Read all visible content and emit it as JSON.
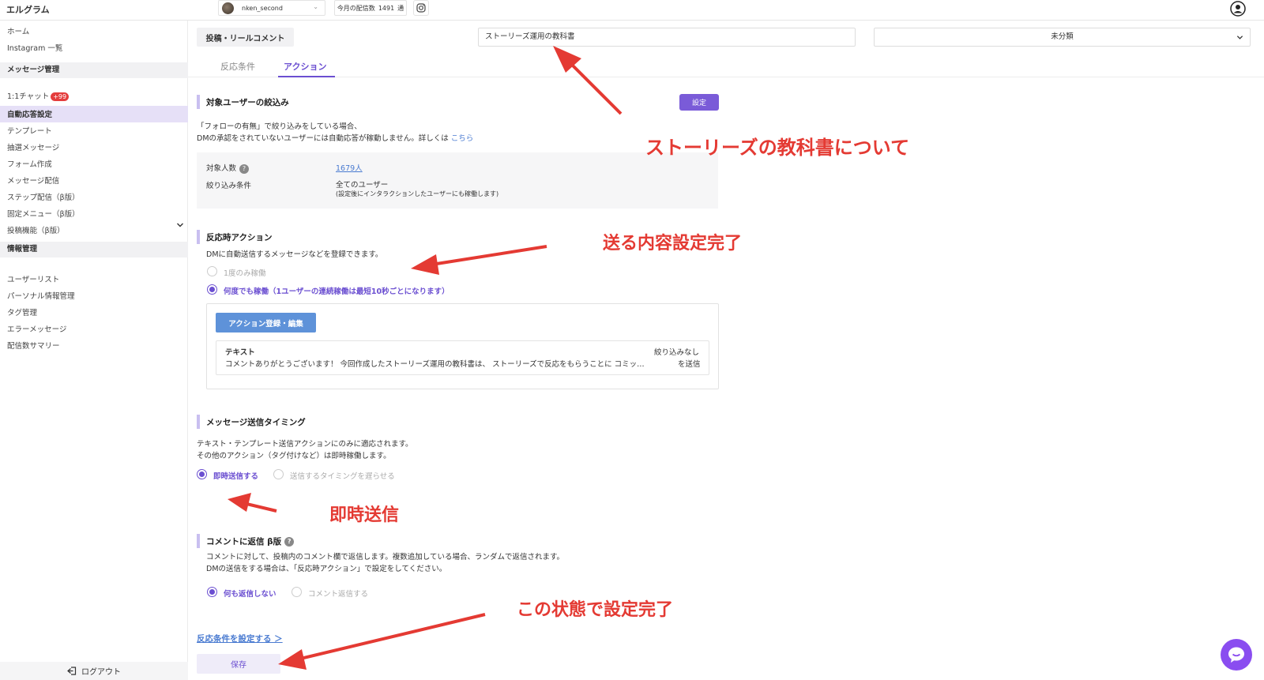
{
  "app": {
    "brand": "エルグラム"
  },
  "header": {
    "account_name": "nken_second",
    "count_label": "今月の配信数",
    "count_value": "1491",
    "count_unit": "通"
  },
  "sidebar": {
    "home": "ホーム",
    "instagram_list": "Instagram 一覧",
    "section_message": "メッセージ管理",
    "chat": "1:1チャット",
    "chat_badge": "+99",
    "auto_reply": "自動応答設定",
    "template": "テンプレート",
    "lottery": "抽選メッセージ",
    "form": "フォーム作成",
    "broadcast": "メッセージ配信",
    "step": "ステップ配信（β版）",
    "fixed_menu": "固定メニュー（β版）",
    "post_feature": "投稿機能（β版）",
    "section_info": "情報管理",
    "user_list": "ユーザーリスト",
    "personal_info": "パーソナル情報管理",
    "tag": "タグ管理",
    "error_msg": "エラーメッセージ",
    "summary": "配信数サマリー",
    "logout": "ログアウト"
  },
  "main": {
    "type_pill": "投稿・リールコメント",
    "title_value": "ストーリーズ運用の教科書",
    "category": "未分類",
    "tabs": [
      {
        "label": "反応条件"
      },
      {
        "label": "アクション"
      }
    ],
    "filter": {
      "title": "対象ユーザーの絞込み",
      "set_button": "設定",
      "note1": "「フォローの有無」で絞り込みをしている場合、",
      "note2": "DMの承認をされていないユーザーには自動応答が稼動しません。詳しくは",
      "note_link": "こちら",
      "count_label": "対象人数",
      "count_value": "1679人",
      "cond_label": "絞り込み条件",
      "cond_value": "全てのユーザー",
      "cond_note": "(設定後にインタラクションしたユーザーにも稼働します)"
    },
    "reaction": {
      "title": "反応時アクション",
      "desc": "DMに自動送信するメッセージなどを登録できます。",
      "opt_once": "1度のみ稼働",
      "opt_many": "何度でも稼働（1ユーザーの連続稼働は最短10秒ごとになります）",
      "action_button": "アクション登録・編集",
      "card_title": "テキスト",
      "card_body": "コメントありがとうございます！ 今回作成したストーリーズ運用の教科書は、 ストーリーズで反応をもらうことに コミッ…",
      "card_right1": "絞り込みなし",
      "card_right2": "を送信"
    },
    "timing": {
      "title": "メッセージ送信タイミング",
      "desc1": "テキスト・テンプレート送信アクションにのみに適応されます。",
      "desc2": "その他のアクション（タグ付けなど）は即時稼働します。",
      "opt_now": "即時送信する",
      "opt_delay": "送信するタイミングを遅らせる"
    },
    "comment_reply": {
      "title": "コメントに返信 β版",
      "desc1": "コメントに対して、投稿内のコメント欄で返信します。複数追加している場合、ランダムで返信されます。",
      "desc2": "DMの送信をする場合は、「反応時アクション」で設定をしてください。",
      "opt_none": "何も返信しない",
      "opt_reply": "コメント返信する"
    },
    "link_condition": "反応条件を設定する ＞",
    "save": "保存"
  },
  "annotations": {
    "a1": "ストーリーズの教科書について",
    "a2": "送る内容設定完了",
    "a3": "即時送信",
    "a4": "この状態で設定完了"
  },
  "colors": {
    "accent": "#6b4fd1",
    "annotation": "#e43a33",
    "action_button": "#5e92d9"
  }
}
